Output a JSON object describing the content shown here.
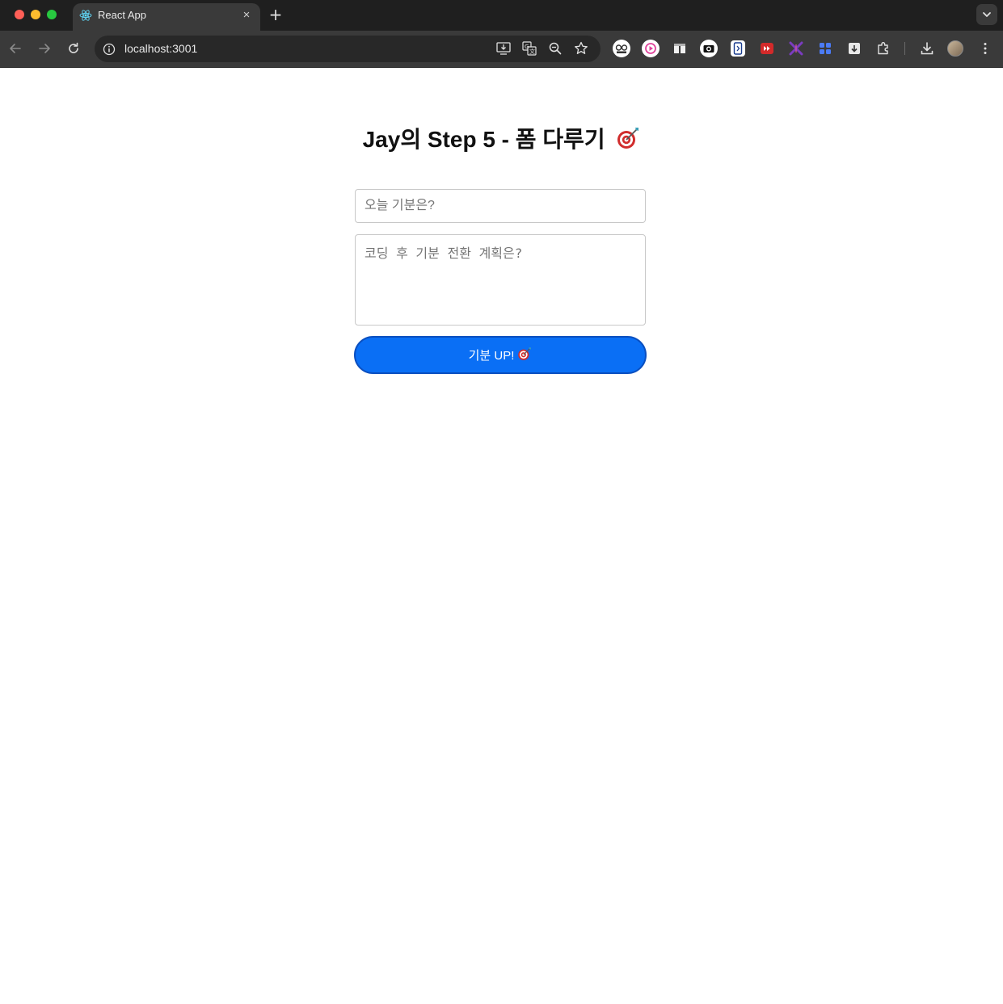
{
  "browser": {
    "tab_title": "React App",
    "url": "localhost:3001",
    "new_tab_symbol": "+",
    "tab_close_symbol": "×",
    "icons": {
      "tab_favicon": "react-logo-icon",
      "back": "back-arrow-icon",
      "forward": "forward-arrow-icon",
      "reload": "reload-icon",
      "site_info": "info-icon",
      "install": "install-app-icon",
      "translate": "translate-icon",
      "zoom": "zoom-icon",
      "bookmark": "star-icon",
      "extensions": [
        "owl-extension-icon",
        "pink-play-extension-icon",
        "panel-extension-icon",
        "camera-extension-icon",
        "phone-extension-icon",
        "red-forward-extension-icon",
        "purple-x-extension-icon",
        "blue-grid-extension-icon",
        "download-box-extension-icon",
        "puzzle-extensions-icon"
      ],
      "downloads": "download-icon",
      "profile": "avatar",
      "menu": "kebab-menu-icon"
    }
  },
  "page": {
    "title": "Jay의 Step 5 - 폼 다루기",
    "title_emoji": "target-icon",
    "mood_input": {
      "placeholder": "오늘 기분은?",
      "value": ""
    },
    "plan_textarea": {
      "placeholder": "코딩 후 기분 전환 계획은?",
      "value": ""
    },
    "submit_button": {
      "label": "기분 UP!",
      "emoji": "target-icon"
    }
  },
  "colors": {
    "button_bg": "#0a6ff5",
    "button_border": "#0a4fc0",
    "chrome_dark": "#1f1f1f",
    "toolbar": "#3a3a3a"
  }
}
